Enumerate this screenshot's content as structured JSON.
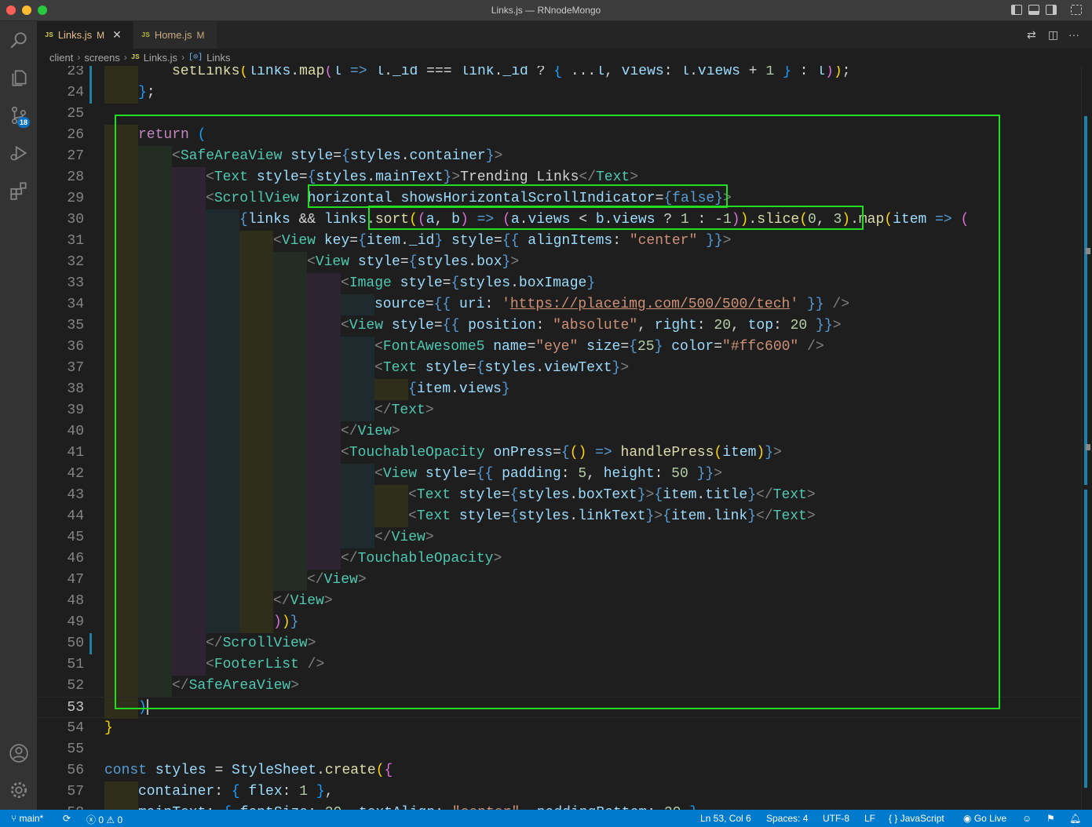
{
  "window": {
    "title": "Links.js — RNnodeMongo",
    "traffic_lights": [
      "#ff5f57",
      "#febc2e",
      "#28c840"
    ]
  },
  "activity_bar": {
    "items": [
      "explorer-icon",
      "search-icon",
      "source-control-icon",
      "run-debug-icon",
      "extensions-icon"
    ],
    "source_control_badge": "18",
    "bottom": [
      "account-icon",
      "settings-gear-icon"
    ]
  },
  "tabs": [
    {
      "icon": "JS",
      "label": "Links.js",
      "status": "M",
      "active": true
    },
    {
      "icon": "JS",
      "label": "Home.js",
      "status": "M",
      "active": false
    }
  ],
  "breadcrumb": {
    "items": [
      "client",
      "screens",
      "Links.js",
      "Links"
    ],
    "file_icon": "JS",
    "symbol_icon": "[⊙]"
  },
  "editor": {
    "current_line": 53,
    "line_numbers": [
      "23",
      "24",
      "25",
      "26",
      "27",
      "28",
      "29",
      "30",
      "31",
      "32",
      "33",
      "34",
      "35",
      "36",
      "37",
      "38",
      "39",
      "40",
      "41",
      "42",
      "43",
      "44",
      "45",
      "46",
      "47",
      "48",
      "49",
      "50",
      "51",
      "52",
      "53",
      "54",
      "55",
      "56",
      "57"
    ]
  },
  "status_bar": {
    "branch": "main*",
    "errors": "0",
    "warnings": "0",
    "cursor": "Ln 53, Col 6",
    "spaces": "Spaces: 4",
    "encoding": "UTF-8",
    "eol": "LF",
    "language": "JavaScript",
    "language_icon": "{ }",
    "go_live": "Go Live"
  },
  "colors": {
    "highlight_box": "#22dd22",
    "status_bar": "#007acc",
    "editor_bg": "#1e1e1e"
  }
}
